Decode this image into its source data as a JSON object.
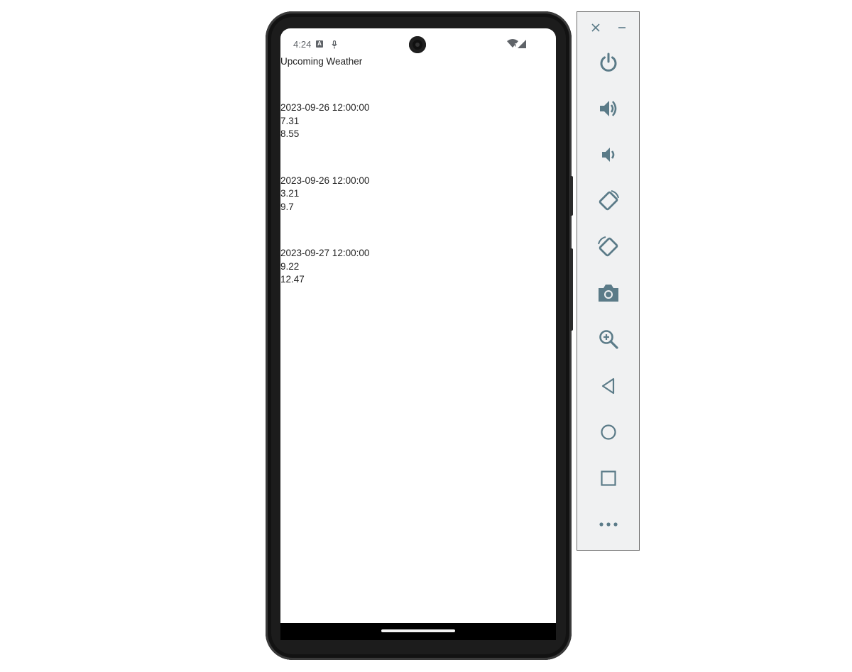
{
  "status_bar": {
    "time": "4:24"
  },
  "app": {
    "title": "Upcoming Weather",
    "forecasts": [
      {
        "datetime": "2023-09-26 12:00:00",
        "value_1": "7.31",
        "value_2": "8.55"
      },
      {
        "datetime": "2023-09-26 12:00:00",
        "value_1": "3.21",
        "value_2": "9.7"
      },
      {
        "datetime": "2023-09-27 12:00:00",
        "value_1": "9.22",
        "value_2": "12.47"
      }
    ]
  },
  "emulator_toolbar": {
    "icon_color": "#5b7b88",
    "buttons": [
      "close-icon",
      "minimize-icon",
      "power-icon",
      "volume-up-icon",
      "volume-down-icon",
      "rotate-left-icon",
      "rotate-right-icon",
      "camera-icon",
      "zoom-icon",
      "back-icon",
      "home-icon",
      "overview-icon",
      "more-icon"
    ]
  }
}
